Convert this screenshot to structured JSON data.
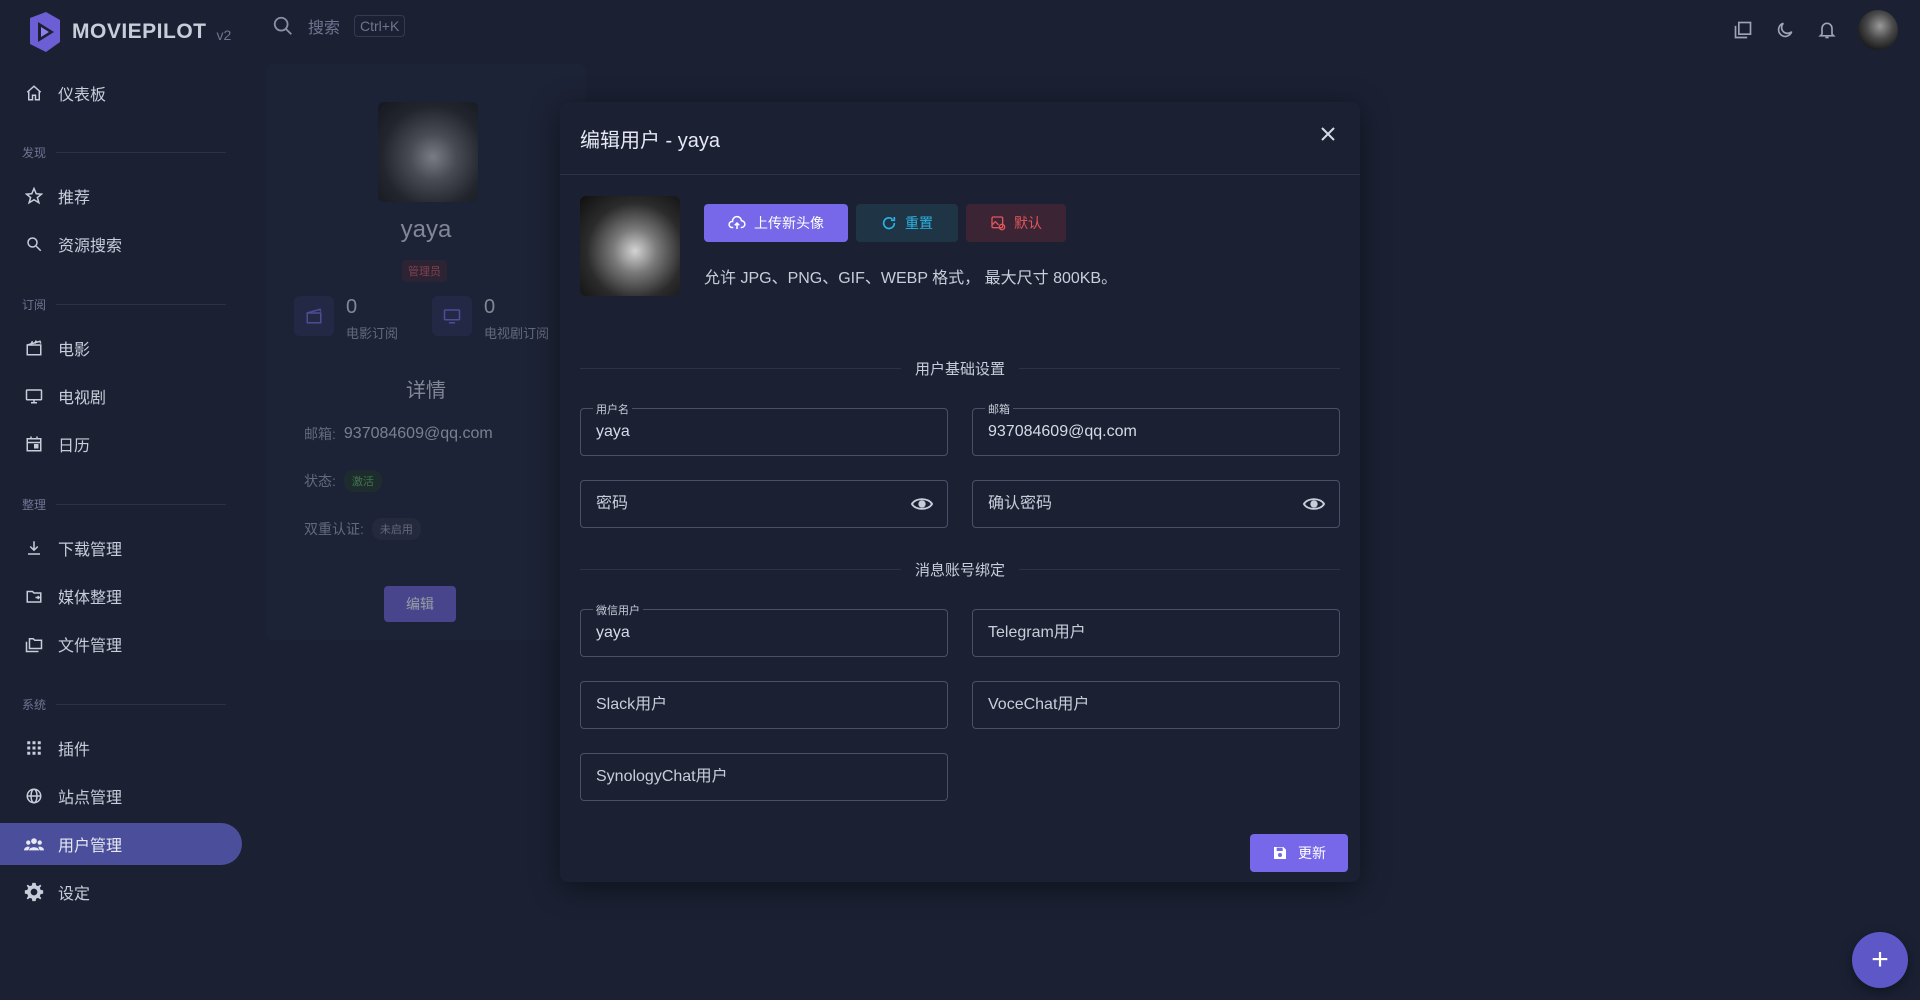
{
  "app": {
    "name": "MOVIEPILOT",
    "version": "v2"
  },
  "search": {
    "placeholder": "搜索",
    "shortcut": "Ctrl+K"
  },
  "sidebar": {
    "dashboard": "仪表板",
    "sections": {
      "discover": "发现",
      "subscribe": "订阅",
      "organize": "整理",
      "system": "系统"
    },
    "items": {
      "recommend": "推荐",
      "resource_search": "资源搜索",
      "movies": "电影",
      "tv": "电视剧",
      "calendar": "日历",
      "download": "下载管理",
      "media_organize": "媒体整理",
      "file_manage": "文件管理",
      "plugins": "插件",
      "sites": "站点管理",
      "users": "用户管理",
      "settings": "设定"
    },
    "active": "users"
  },
  "profile_card": {
    "name": "yaya",
    "role": "管理员",
    "movie_subs": {
      "count": "0",
      "label": "电影订阅"
    },
    "tv_subs": {
      "count": "0",
      "label": "电视剧订阅"
    },
    "details_title": "详情",
    "email_label": "邮箱:",
    "email": "937084609@qq.com",
    "status_label": "状态:",
    "status": "激活",
    "twofa_label": "双重认证:",
    "twofa": "未启用",
    "edit_label": "编辑"
  },
  "dialog": {
    "title": "编辑用户 - yaya",
    "upload_label": "上传新头像",
    "reset_label": "重置",
    "default_label": "默认",
    "hint": "允许 JPG、PNG、GIF、WEBP 格式， 最大尺寸 800KB。",
    "basic_section": "用户基础设置",
    "binding_section": "消息账号绑定",
    "fields": {
      "username": {
        "label": "用户名",
        "value": "yaya"
      },
      "email": {
        "label": "邮箱",
        "value": "937084609@qq.com"
      },
      "password": {
        "placeholder": "密码"
      },
      "confirm_password": {
        "placeholder": "确认密码"
      },
      "wechat": {
        "label": "微信用户",
        "value": "yaya"
      },
      "telegram": {
        "placeholder": "Telegram用户"
      },
      "slack": {
        "placeholder": "Slack用户"
      },
      "vocechat": {
        "placeholder": "VoceChat用户"
      },
      "synology": {
        "placeholder": "SynologyChat用户"
      }
    },
    "update_label": "更新"
  },
  "colors": {
    "background": "#1b2133",
    "accent": "#7668e8",
    "active_nav": "#4b4f9b",
    "info": "#2bb3e3",
    "danger": "#e0565f"
  }
}
